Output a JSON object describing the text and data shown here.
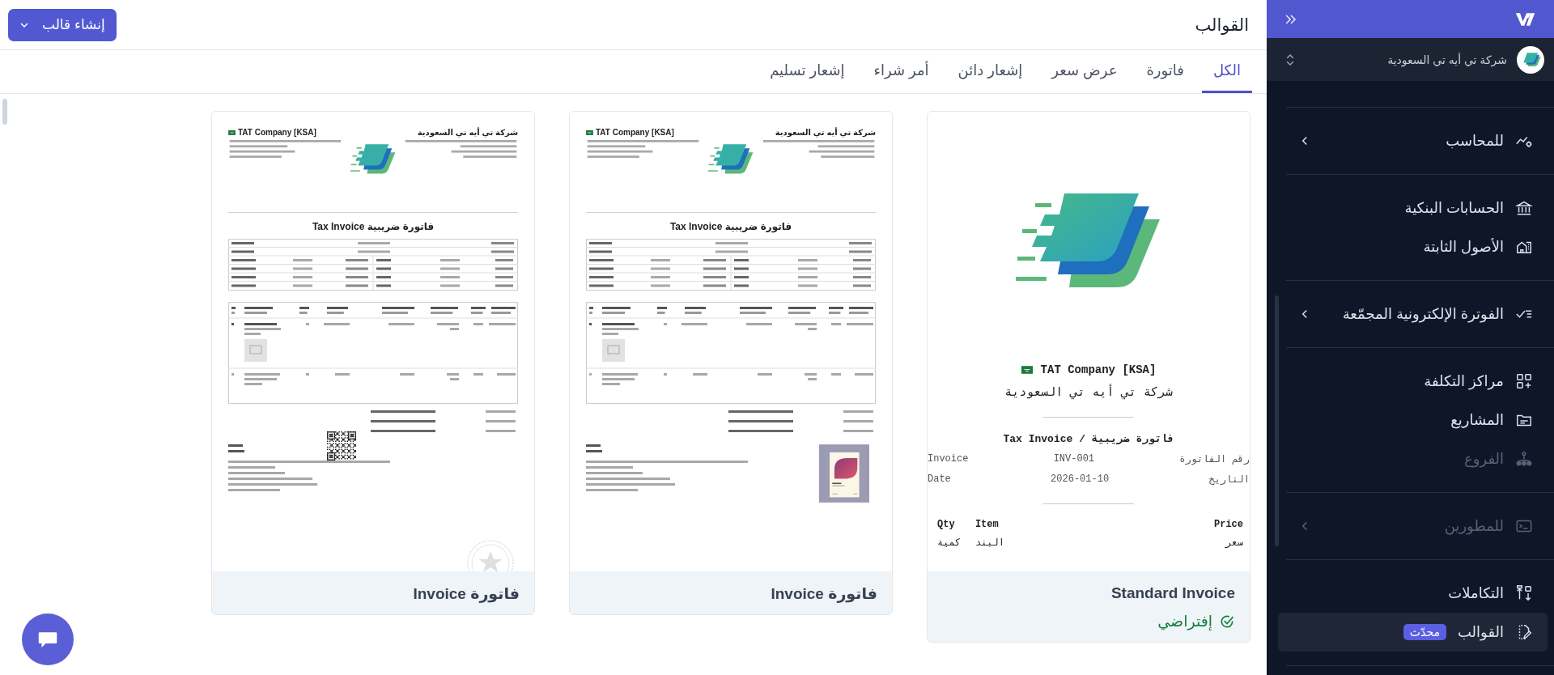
{
  "sidebar": {
    "company": "شركة تي أيه تي السعودية",
    "sections": [
      {
        "items": [
          {
            "label": "للمحاسب",
            "kind": "group",
            "expanded": false,
            "disabled": false,
            "selected": false
          }
        ]
      },
      {
        "items": [
          {
            "label": "الحسابات البنكية",
            "kind": "link",
            "disabled": false,
            "selected": false
          },
          {
            "label": "الأصول الثابتة",
            "kind": "link",
            "disabled": false,
            "selected": false
          }
        ]
      },
      {
        "items": [
          {
            "label": "الفوترة الإلكترونية المجمّعة",
            "kind": "group",
            "expanded": false,
            "disabled": false,
            "selected": false
          }
        ]
      },
      {
        "items": [
          {
            "label": "مراكز التكلفة",
            "kind": "link",
            "disabled": false,
            "selected": false
          },
          {
            "label": "المشاريع",
            "kind": "link",
            "disabled": false,
            "selected": false
          },
          {
            "label": "الفروع",
            "kind": "link",
            "disabled": true,
            "selected": false
          }
        ]
      },
      {
        "items": [
          {
            "label": "للمطورين",
            "kind": "group",
            "expanded": false,
            "disabled": true,
            "selected": false
          }
        ]
      },
      {
        "items": [
          {
            "label": "التكاملات",
            "kind": "link",
            "disabled": false,
            "selected": false
          },
          {
            "label": "القوالب",
            "kind": "link",
            "disabled": false,
            "selected": true,
            "badge": "محدّث"
          }
        ]
      }
    ]
  },
  "page": {
    "title": "القوالب",
    "create_button": "إنشاء قالب"
  },
  "tabs": [
    {
      "label": "الكل",
      "selected": true
    },
    {
      "label": "فاتورة",
      "selected": false
    },
    {
      "label": "عرض سعر",
      "selected": false
    },
    {
      "label": "إشعار دائن",
      "selected": false
    },
    {
      "label": "أمر شراء",
      "selected": false
    },
    {
      "label": "إشعار تسليم",
      "selected": false
    }
  ],
  "cards": [
    {
      "title": "Standard Invoice",
      "badge": "إفتراضي",
      "preview": {
        "kind": "standard",
        "company_en": "TAT Company [KSA]",
        "company_ar": "شركة تي أيه تي السعودية",
        "title": "Tax Invoice / فاتورة ضريبية",
        "fields": [
          {
            "label": "Invoice",
            "value": "INV-001",
            "label_ar": "رقم الفاتورة"
          },
          {
            "label": "Date",
            "value": "2026-01-10",
            "label_ar": "التاريخ"
          }
        ],
        "columns": [
          {
            "en": "Price",
            "ar": "سعر"
          },
          {
            "en": "Item",
            "ar": "البند"
          },
          {
            "en": "Qty",
            "ar": "كمية"
          }
        ]
      }
    },
    {
      "title": "Invoice فاتورة",
      "preview": {
        "kind": "detailed",
        "company_en": "TAT Company [KSA]",
        "company_ar": "شركة تي أيه تي السعودية",
        "title": "Tax Invoice فاتورة ضريبية"
      }
    },
    {
      "title": "Invoice فاتورة",
      "preview": {
        "kind": "detailed",
        "qr": true,
        "stamp": true,
        "company_en": "TAT Company [KSA]",
        "company_ar": "شركة تي أيه تي السعودية",
        "title": "Tax Invoice فاتورة ضريبية"
      }
    }
  ]
}
